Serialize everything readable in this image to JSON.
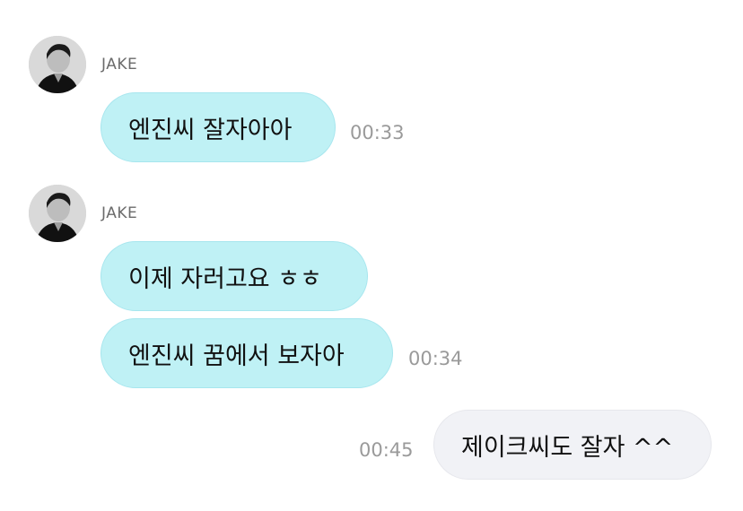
{
  "messages": [
    {
      "sender": "JAKE",
      "text": "엔진씨 잘자아아",
      "time": "00:33"
    },
    {
      "sender": "JAKE",
      "text": "이제 자러고요 ㅎㅎ"
    },
    {
      "text": "엔진씨 꿈에서 보자아",
      "time": "00:34"
    },
    {
      "text": "제이크씨도 잘자 ^^",
      "time": "00:45",
      "outgoing": true
    }
  ],
  "colors": {
    "incoming_bubble": "#bff1f5",
    "outgoing_bubble": "#f1f2f6",
    "timestamp": "#9a9a9a",
    "sender_name": "#6b6b6b"
  },
  "icons": {
    "avatar": "profile-photo-avatar"
  }
}
